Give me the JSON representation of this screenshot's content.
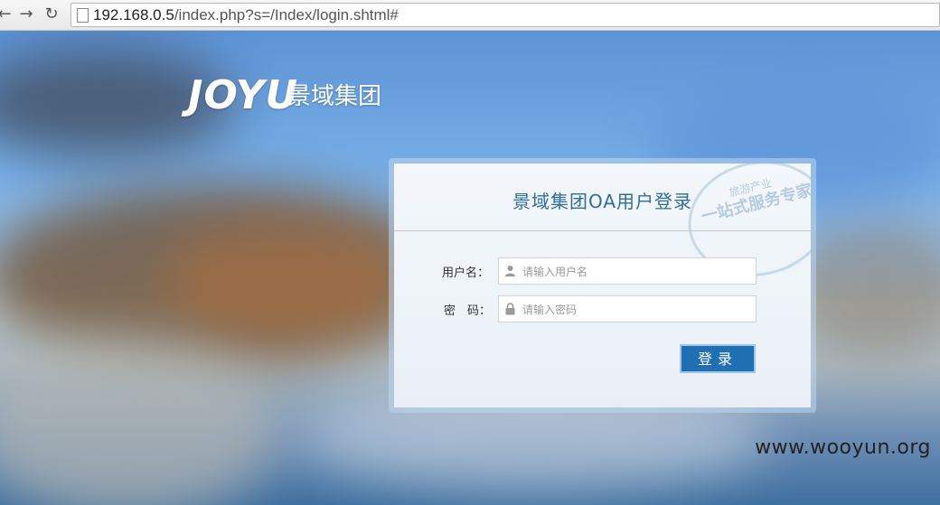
{
  "browser": {
    "back_icon": "back-arrow-icon",
    "forward_icon": "forward-arrow-icon",
    "reload_icon": "reload-icon",
    "url_host": "192.168.0.5",
    "url_path": "/index.php?s=/Index/login.shtml#"
  },
  "logo": {
    "word": "JOYU",
    "cn": "景域集团"
  },
  "login": {
    "title": "景域集团OA用户登录",
    "stamp_top": "旅游产业",
    "stamp_main": "一站式服务专家",
    "username_label": "用户名：",
    "username_placeholder": "请输入用户名",
    "password_label": "密　码：",
    "password_placeholder": "请输入密码",
    "submit_label": "登录"
  },
  "watermark": "www.wooyun.org"
}
